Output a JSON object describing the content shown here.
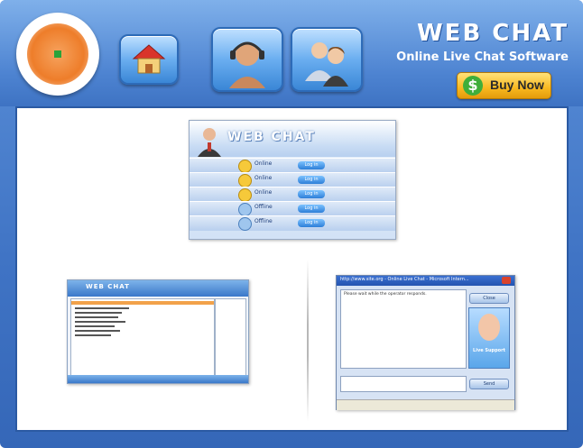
{
  "header": {
    "brand_title": "WEB CHAT",
    "brand_subtitle": "Online Live Chat Software",
    "buy_button": "Buy Now",
    "buy_icon": "$",
    "nav_icons": [
      "home-icon",
      "support-agent-icon",
      "users-icon"
    ]
  },
  "screenshots": {
    "chat_panel": {
      "title": "WEB CHAT",
      "rows": [
        {
          "status": "Online",
          "action": "Log in",
          "mood": "happy"
        },
        {
          "status": "Online",
          "action": "Log in",
          "mood": "happy"
        },
        {
          "status": "Online",
          "action": "Log in",
          "mood": "happy"
        },
        {
          "status": "Offline",
          "action": "Log in",
          "mood": "sad"
        },
        {
          "status": "Offline",
          "action": "Log in",
          "mood": "sad"
        }
      ]
    },
    "operator_console": {
      "title": "WEB CHAT"
    },
    "browser_chat": {
      "titlebar": "http://www.site.org - Online Live Chat - Microsoft Intern...",
      "message": "Please wait while the operator responds.",
      "close_button": "Close",
      "live_label": "Live Support",
      "send_button": "Send"
    }
  },
  "colors": {
    "frame_blue": "#3f73c4",
    "accent_orange": "#f8b820",
    "panel_white": "#ffffff"
  }
}
